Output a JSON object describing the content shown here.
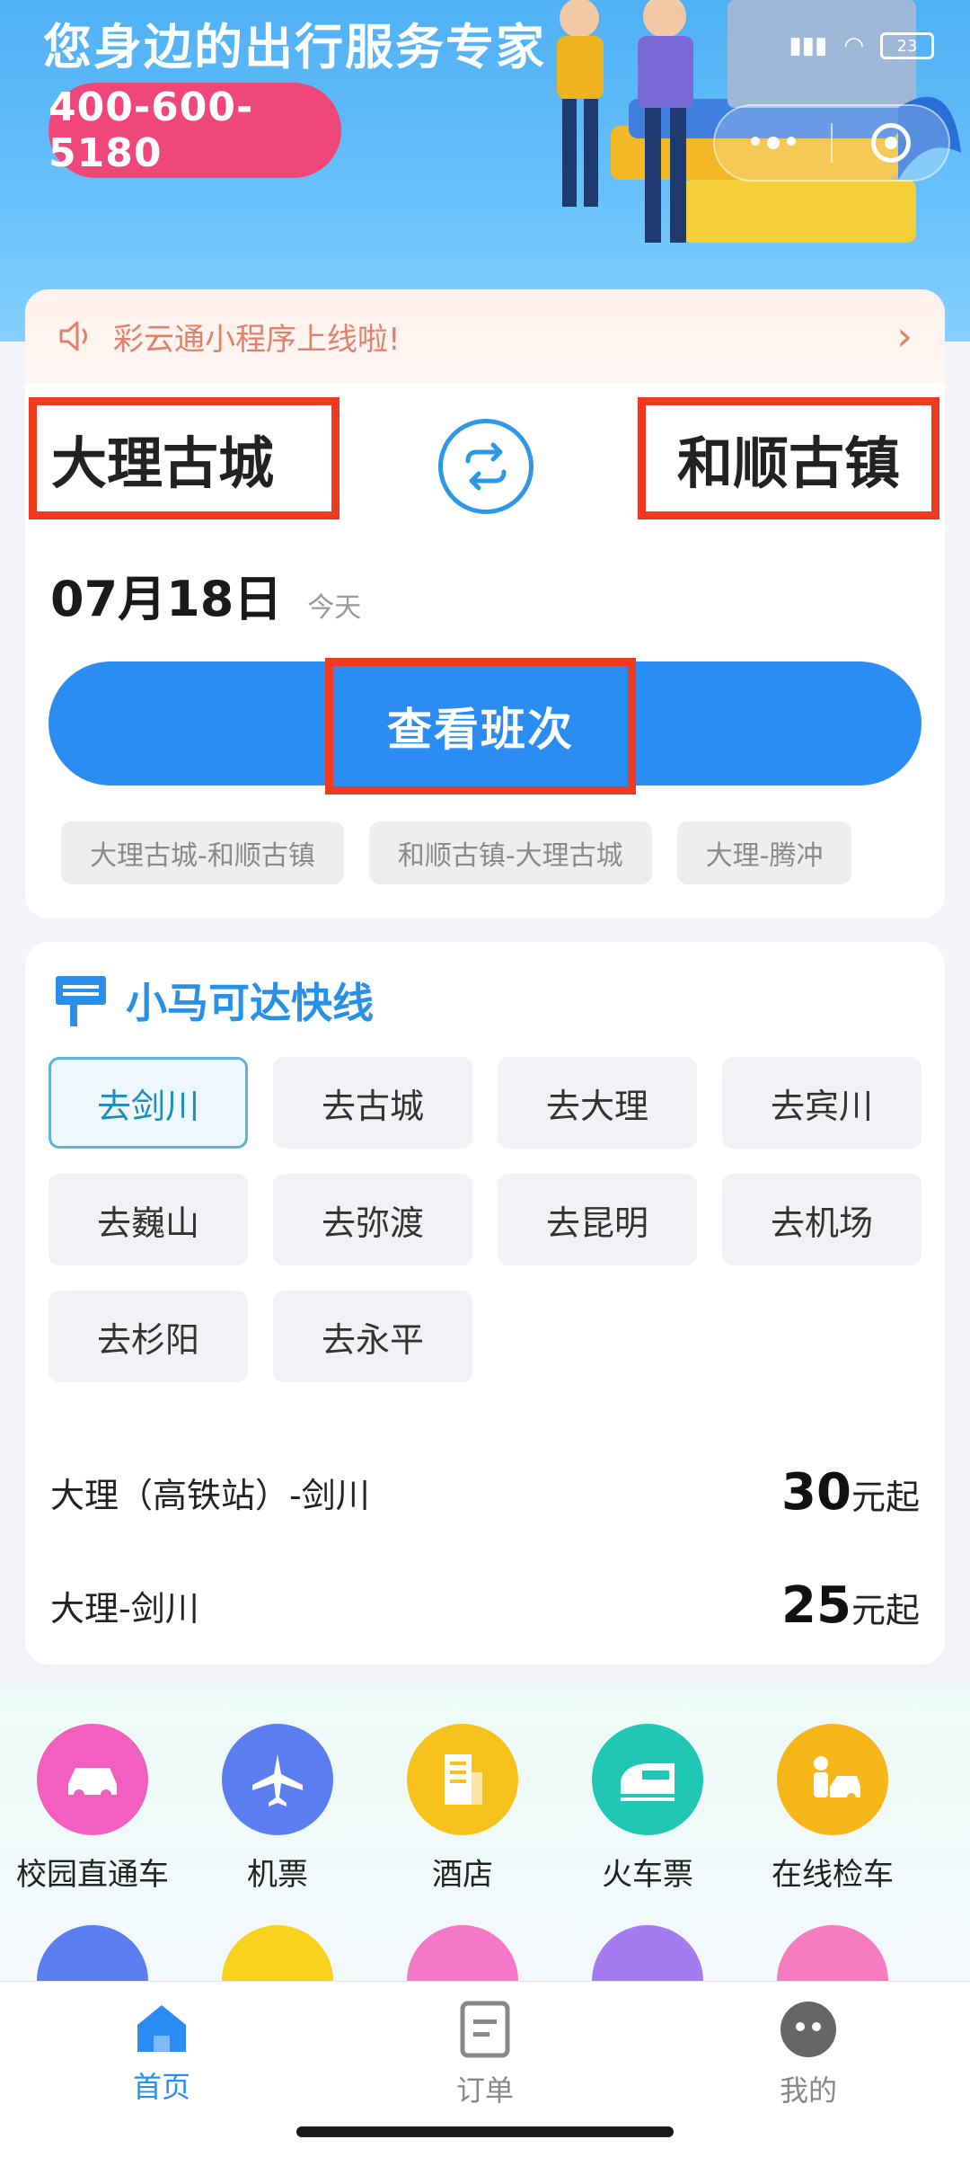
{
  "banner": {
    "slogan": "您身边的出行服务专家",
    "phone": "400-600-5180"
  },
  "status": {
    "battery": "23"
  },
  "notice": {
    "text": "彩云通小程序上线啦!"
  },
  "route": {
    "from": "大理古城",
    "to": "和顺古镇",
    "date": "07月18日",
    "date_hint": "今天",
    "search_label": "查看班次",
    "history": [
      "大理古城-和顺古镇",
      "和顺古镇-大理古城",
      "大理-腾冲"
    ]
  },
  "express": {
    "title": "小马可达快线",
    "destinations": [
      "去剑川",
      "去古城",
      "去大理",
      "去宾川",
      "去巍山",
      "去弥渡",
      "去昆明",
      "去机场",
      "去杉阳",
      "去永平"
    ],
    "selected": "去剑川",
    "routes": [
      {
        "name": "大理（高铁站）-剑川",
        "price": "30",
        "unit": "元起"
      },
      {
        "name": "大理-剑川",
        "price": "25",
        "unit": "元起"
      }
    ]
  },
  "services": [
    {
      "label": "校园直通车",
      "icon": "car-icon",
      "color": "#f25fbf"
    },
    {
      "label": "机票",
      "icon": "airplane-icon",
      "color": "#5b7ef0"
    },
    {
      "label": "酒店",
      "icon": "building-icon",
      "color": "#f7c21c"
    },
    {
      "label": "火车票",
      "icon": "train-icon",
      "color": "#1fc7b4"
    },
    {
      "label": "在线检车",
      "icon": "car-inspection-icon",
      "color": "#f7b61a"
    }
  ],
  "tabs": [
    {
      "label": "首页",
      "icon": "home-icon",
      "active": true
    },
    {
      "label": "订单",
      "icon": "order-icon",
      "active": false
    },
    {
      "label": "我的",
      "icon": "profile-icon",
      "active": false
    }
  ],
  "colors": {
    "primary": "#2b8df3",
    "highlight": "#f03a1f",
    "pill": "#f0477a"
  }
}
